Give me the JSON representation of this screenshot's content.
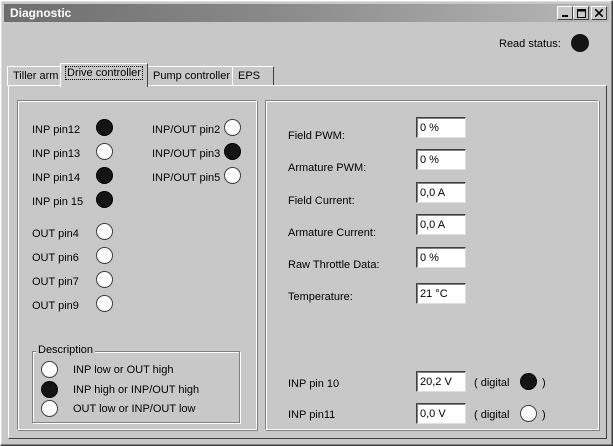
{
  "window": {
    "title": "Diagnostic"
  },
  "read_status": {
    "label": "Read status:",
    "state": "on"
  },
  "tabs": [
    {
      "label": "Tiller arm",
      "active": false
    },
    {
      "label": "Drive controller",
      "active": true
    },
    {
      "label": "Pump controller",
      "active": false
    },
    {
      "label": "EPS",
      "active": false
    }
  ],
  "left_panel": {
    "pins_col1": [
      {
        "label": "INP pin12",
        "state": "on"
      },
      {
        "label": "INP pin13",
        "state": "off"
      },
      {
        "label": "INP pin14",
        "state": "on"
      },
      {
        "label": "INP pin 15",
        "state": "on"
      },
      {
        "label": "OUT pin4",
        "state": "off"
      },
      {
        "label": "OUT pin6",
        "state": "off"
      },
      {
        "label": "OUT pin7",
        "state": "off"
      },
      {
        "label": "OUT pin9",
        "state": "off"
      }
    ],
    "pins_col2": [
      {
        "label": "INP/OUT pin2",
        "state": "off"
      },
      {
        "label": "INP/OUT pin3",
        "state": "on"
      },
      {
        "label": "INP/OUT pin5",
        "state": "off"
      }
    ],
    "description": {
      "title": "Description",
      "items": [
        {
          "text": "INP low  or  OUT high",
          "state": "off"
        },
        {
          "text": "INP high  or  INP/OUT high",
          "state": "on"
        },
        {
          "text": "OUT low or  INP/OUT low",
          "state": "off"
        }
      ]
    }
  },
  "right_panel": {
    "fields": [
      {
        "label": "Field PWM:",
        "value": "0 %"
      },
      {
        "label": "Armature PWM:",
        "value": "0 %"
      },
      {
        "label": "Field Current:",
        "value": "0,0 A"
      },
      {
        "label": "Armature Current:",
        "value": "0,0 A"
      },
      {
        "label": "Raw Throttle Data:",
        "value": "0 %"
      },
      {
        "label": "Temperature:",
        "value": "21 °C"
      }
    ],
    "inputs": [
      {
        "label": "INP pin 10",
        "value": "20,2 V",
        "digital_prefix": "( digital",
        "digital_suffix": ")",
        "state": "on"
      },
      {
        "label": "INP pin11",
        "value": "0,0 V",
        "digital_prefix": "( digital",
        "digital_suffix": ")",
        "state": "off"
      }
    ]
  },
  "colors": {
    "led_on": "#141414",
    "led_off": "#ffffff",
    "face": "#c8c8c8"
  }
}
